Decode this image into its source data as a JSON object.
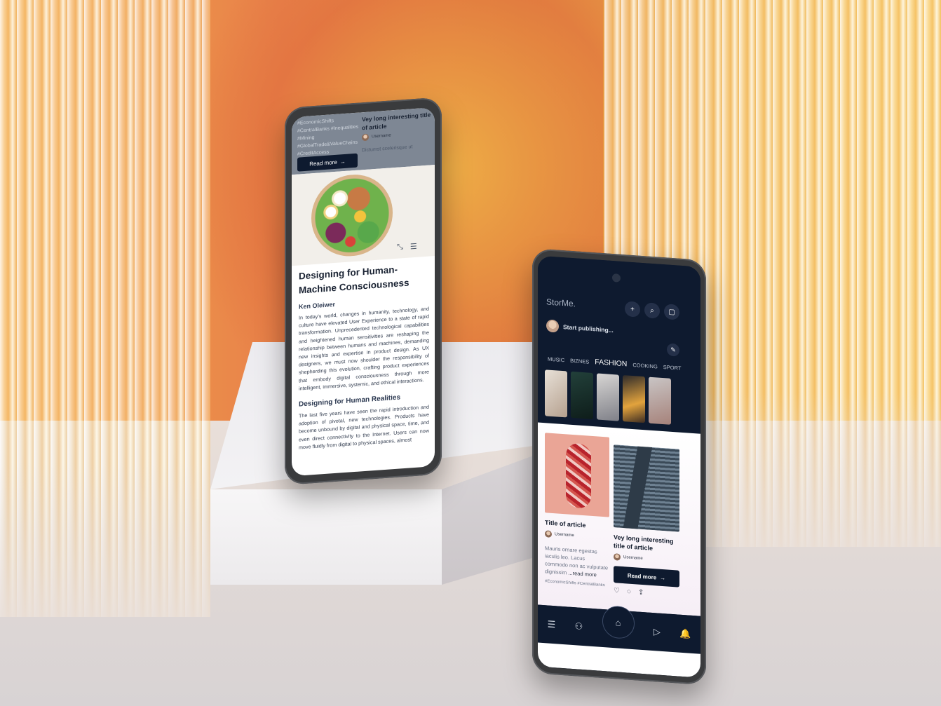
{
  "left_phone": {
    "top_card": {
      "tags": "#EconomicShifts #CentralBanks #Inequalities #Mining #GlobalTrade&ValueChains #CreditAccess",
      "read_more": "Read more",
      "side_title": "Vey long interesting title of article",
      "side_user": "Username",
      "side_text": "Dictumst scelerisque ut"
    },
    "article": {
      "title": "Designing for Human-Machine Consciousness",
      "author": "Ken Oleiwer",
      "paragraph1": "In today's world, changes in humanity, technology, and culture have elevated User Experience to a state of rapid transformation. Unprecedented technological capabilities and heightened human sensitivities are reshaping the relationship between humans and machines, demanding new insights and expertise in product design. As UX designers, we must now shoulder the responsibility of shepherding this evolution, crafting product experiences that embody digital consciousness through more intelligent, immersive, systemic, and ethical interactions.",
      "subheading": "Designing for Human Realities",
      "paragraph2": "The last five years have seen the rapid introduction and adoption of pivotal, new technologies. Products have become unbound by digital and physical space, time, and even direct connectivity to the Internet. Users can now move fluidly from digital to physical spaces, almost"
    },
    "icons": [
      "collapse-icon",
      "menu-icon"
    ]
  },
  "right_phone": {
    "logo": "StorMe.",
    "publish_prompt": "Start publishing...",
    "categories": [
      "MUSIC",
      "BIZNES",
      "FASHION",
      "COOKING",
      "SPORT"
    ],
    "active_category": "FASHION",
    "cards": [
      {
        "title": "Title of article",
        "user": "Username",
        "text": "Mauris ornare egestas iaculis leo. Lacus commodo non ac vulputate dignissim",
        "more": "...read more",
        "tags": "#EconomicShifts #CentralBanks"
      },
      {
        "title": "Vey long interesting title of article",
        "user": "Username",
        "read_more": "Read more"
      }
    ],
    "nav": [
      "menu-icon",
      "people-icon",
      "home-icon",
      "play-icon",
      "bell-icon"
    ]
  }
}
